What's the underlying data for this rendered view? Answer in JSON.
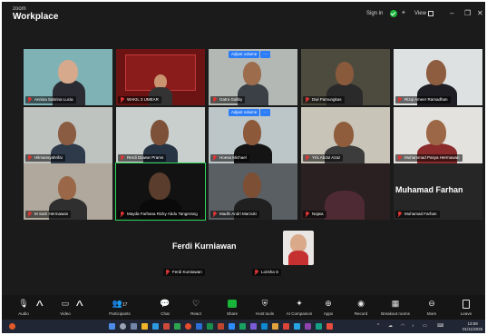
{
  "window": {
    "brand_small": "zoom",
    "brand_big": "Workplace",
    "sign_in": "Sign in",
    "view": "View",
    "minimize": "–",
    "restore": "❐",
    "close": "✕"
  },
  "meeting": {
    "adjust_label": "Adjust volume",
    "tiles": [
      {
        "name": "Annisa Sabrina Lucia"
      },
      {
        "name": "WAKIL 3 UMEAR"
      },
      {
        "name": "Gatra Galiby"
      },
      {
        "name": "Dwi Pamungkas"
      },
      {
        "name": "Rizqi Ameer Ramadhan"
      },
      {
        "name": "Hilmansyahrifai"
      },
      {
        "name": "Rerdi Diawar Prams"
      },
      {
        "name": "Hoesa Michael"
      },
      {
        "name": "Yric Abdul Azaz"
      },
      {
        "name": "Muhammad Pasya Hermawan"
      },
      {
        "name": "M Satri Hermawan"
      },
      {
        "name": "Mayda Farhana Rizky Abdu Tangerang"
      },
      {
        "name": "Madhi Andri Marzuki"
      },
      {
        "name": "Najwa"
      },
      {
        "name": "Muhamad Farhan",
        "big": "Muhamad Farhan"
      },
      {
        "name": "Ferdi Kurniawan",
        "big": "Ferdi Kurniawan"
      },
      {
        "name": "Lorisha S"
      }
    ]
  },
  "toolbar": {
    "audio": "Audio",
    "video": "Video",
    "participants": "Participants",
    "participants_count": "17",
    "chat": "Chat",
    "react": "React",
    "share": "Share",
    "host_tools": "Host tools",
    "ai_companion": "AI Companion",
    "apps": "Apps",
    "record": "Record",
    "breakout_rooms": "Breakout rooms",
    "more": "More",
    "leave": "Leave"
  },
  "taskbar": {
    "time": "13:58",
    "date": "01/11/2025"
  }
}
